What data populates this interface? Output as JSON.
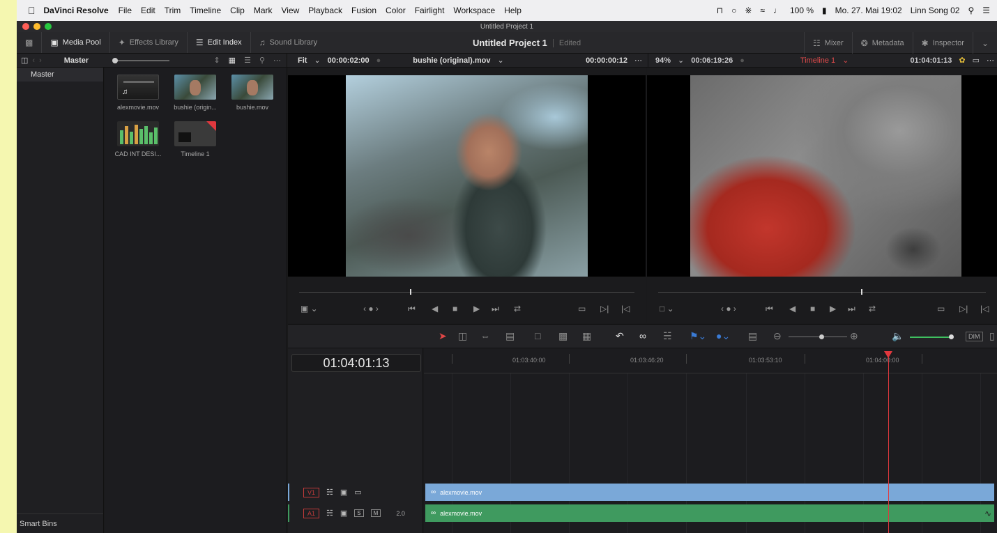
{
  "menubar": {
    "apple": "",
    "app_name": "DaVinci Resolve",
    "items": [
      "File",
      "Edit",
      "Trim",
      "Timeline",
      "Clip",
      "Mark",
      "View",
      "Playback",
      "Fusion",
      "Color",
      "Fairlight",
      "Workspace",
      "Help"
    ],
    "battery": "100 %",
    "datetime": "Mo. 27. Mai 19:02",
    "user": "Linn Song 02"
  },
  "window": {
    "title": "Untitled Project 1"
  },
  "toolbar": {
    "media_pool": "Media Pool",
    "effects_library": "Effects Library",
    "edit_index": "Edit Index",
    "sound_library": "Sound Library",
    "project_title": "Untitled Project 1",
    "edited": "Edited",
    "mixer": "Mixer",
    "metadata": "Metadata",
    "inspector": "Inspector"
  },
  "media_pool": {
    "bin_header": "Master",
    "bin_item": "Master",
    "smart_bins": "Smart Bins",
    "clips": [
      {
        "label": "alexmovie.mov"
      },
      {
        "label": "bushie (origin..."
      },
      {
        "label": "bushie.mov"
      },
      {
        "label": "CAD INT DESI..."
      },
      {
        "label": "Timeline 1"
      }
    ]
  },
  "source_viewer": {
    "zoom": "Fit",
    "duration": "00:00:02:00",
    "clip_name": "bushie (original).mov",
    "timecode": "00:00:00:12",
    "scrub_fraction": 0.33
  },
  "program_viewer": {
    "zoom": "94%",
    "duration": "00:06:19:26",
    "timeline_name": "Timeline 1",
    "timecode": "01:04:01:13",
    "scrub_fraction": 0.62
  },
  "timeline": {
    "current_timecode": "01:04:01:13",
    "ruler_labels": [
      "01:03:40:00",
      "01:03:46:20",
      "01:03:53:10",
      "01:04:00:00"
    ],
    "tracks": [
      {
        "id": "V1",
        "clip": "alexmovie.mov"
      },
      {
        "id": "A1",
        "clip": "alexmovie.mov",
        "solo": "S",
        "mute": "M",
        "volume": "2.0"
      }
    ],
    "dim": "DIM"
  },
  "colors": {
    "video_clip": "#7aa8d8",
    "audio_clip": "#3f9a5f",
    "playhead": "#e0383e"
  }
}
